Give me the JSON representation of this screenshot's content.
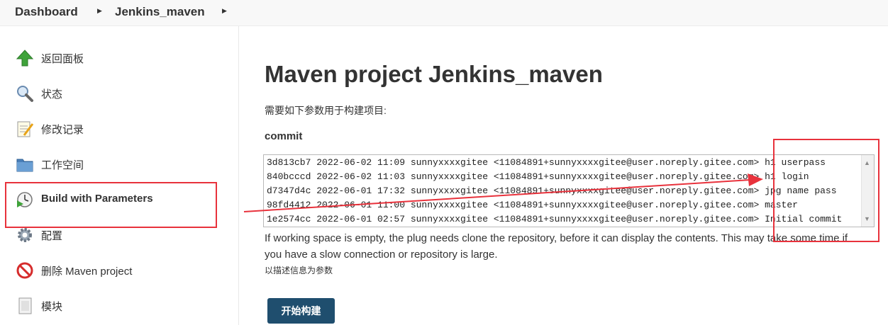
{
  "breadcrumb": {
    "items": [
      "Dashboard",
      "Jenkins_maven"
    ]
  },
  "sidebar": {
    "items": [
      {
        "label": "返回面板",
        "icon": "up-arrow-icon"
      },
      {
        "label": "状态",
        "icon": "search-icon"
      },
      {
        "label": "修改记录",
        "icon": "notepad-icon"
      },
      {
        "label": "工作空间",
        "icon": "folder-icon"
      },
      {
        "label": "Build with Parameters",
        "icon": "clock-play-icon"
      },
      {
        "label": "配置",
        "icon": "gear-icon"
      },
      {
        "label": "删除 Maven project",
        "icon": "no-entry-icon"
      },
      {
        "label": "模块",
        "icon": "document-icon"
      }
    ]
  },
  "main": {
    "title": "Maven project Jenkins_maven",
    "description": "需要如下参数用于构建项目:",
    "parameter": {
      "name": "commit",
      "options": [
        "3d813cb7 2022-06-02 11:09 sunnyxxxxgitee <11084891+sunnyxxxxgitee@user.noreply.gitee.com> h1 userpass",
        "840bcccd 2022-06-02 11:03 sunnyxxxxgitee <11084891+sunnyxxxxgitee@user.noreply.gitee.com> h1 login",
        "d7347d4c 2022-06-01 17:32 sunnyxxxxgitee <11084891+sunnyxxxxgitee@user.noreply.gitee.com> jpg name pass",
        "98fd4412 2022-06-01 11:00 sunnyxxxxgitee <11084891+sunnyxxxxgitee@user.noreply.gitee.com> master",
        "1e2574cc 2022-06-01 02:57 sunnyxxxxgitee <11084891+sunnyxxxxgitee@user.noreply.gitee.com> Initial commit"
      ]
    },
    "help_text": "If working space is empty, the plug needs clone the repository, before it can display the contents. This may take some time if you have a slow connection or repository is large.",
    "help_small": "以描述信息为参数",
    "build_button": "开始构建"
  },
  "colors": {
    "annotation_red": "#e8323c",
    "button_bg": "#1f4e6e"
  }
}
